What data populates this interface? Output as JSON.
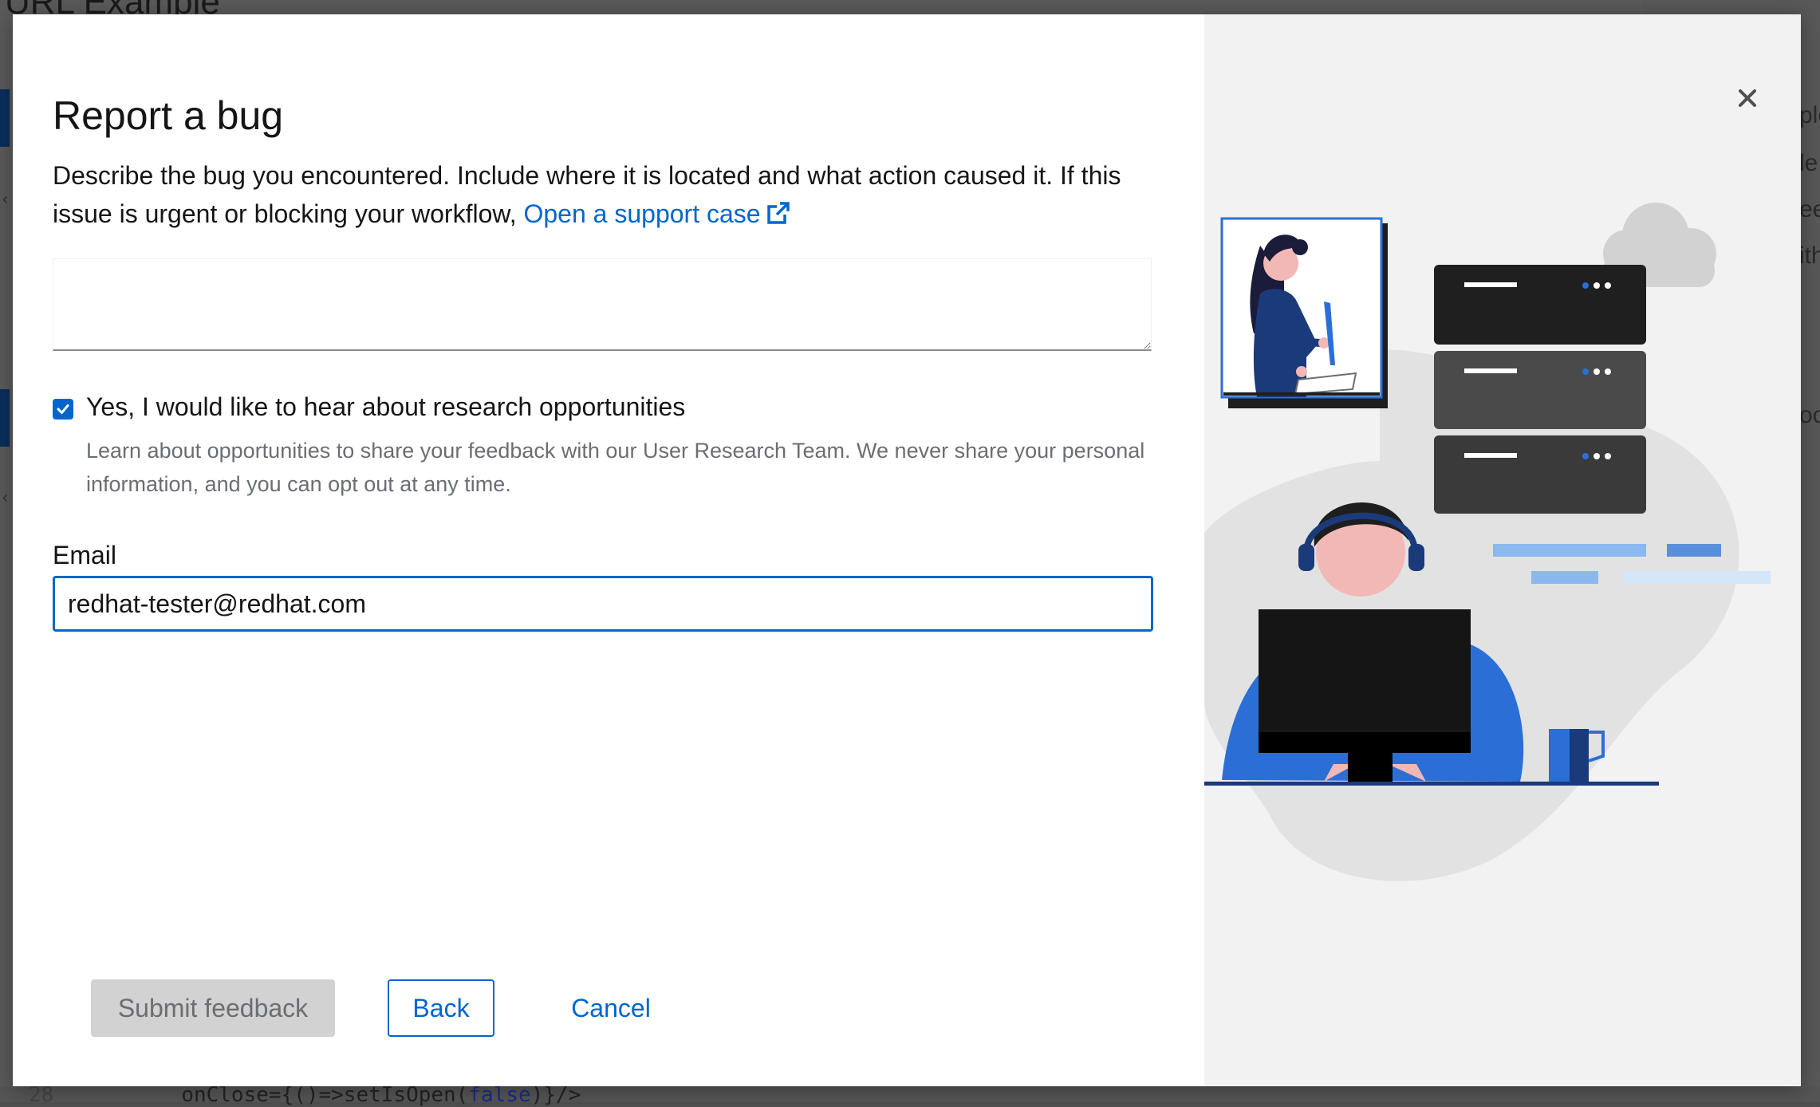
{
  "background": {
    "page_title": "URL Example",
    "right_fragments": [
      "ple",
      "le",
      "ee",
      "ith",
      "oo"
    ],
    "code_line_number": "28",
    "code_text_before": "onClose={()=>setIsOpen(",
    "code_keyword": "false",
    "code_text_after": ")}/>"
  },
  "modal": {
    "title": "Report a bug",
    "description": "Describe the bug you encountered. Include where it is located and what action caused it. If this issue is urgent or blocking your workflow, ",
    "support_link": "Open a support case",
    "bug_textarea_value": "",
    "research_checkbox": {
      "checked": true,
      "label": "Yes, I would like to hear about research opportunities",
      "help": "Learn about opportunities to share your feedback with our User Research Team. We never share your personal information, and you can opt out at any time."
    },
    "email": {
      "label": "Email",
      "value": "redhat-tester@redhat.com"
    },
    "buttons": {
      "submit": "Submit feedback",
      "back": "Back",
      "cancel": "Cancel"
    }
  },
  "colors": {
    "accent": "#0066cc",
    "disabled_bg": "#d2d2d2",
    "illustration_blue": "#2b6fd6",
    "illustration_navy": "#1b3a7a",
    "server_dark": "#1f1f1f",
    "server_gray": "#4a4a4a"
  },
  "icons": {
    "close": "close-icon",
    "external_link": "external-link-icon",
    "checkmark": "checkmark-icon"
  }
}
